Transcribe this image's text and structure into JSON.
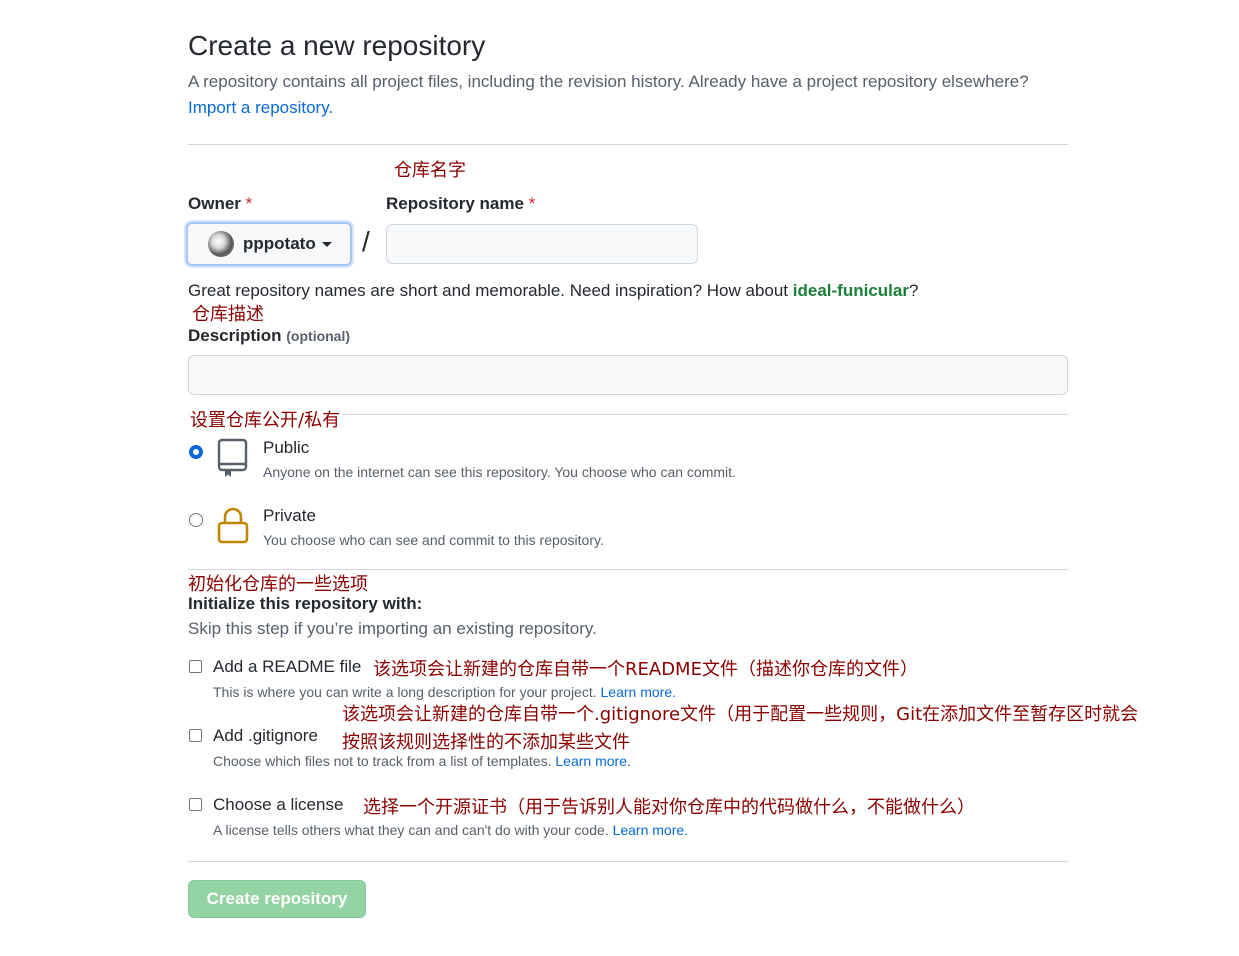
{
  "header": {
    "title": "Create a new repository",
    "subtitle": "A repository contains all project files, including the revision history. Already have a project repository elsewhere?",
    "import_link": "Import a repository."
  },
  "annotations": {
    "repo_name": "仓库名字",
    "description": "仓库描述",
    "visibility": "设置仓库公开/私有",
    "init": "初始化仓库的一些选项",
    "readme": "该选项会让新建的仓库自带一个README文件（描述你仓库的文件）",
    "gitignore_line1": "该选项会让新建的仓库自带一个.gitignore文件（用于配置一些规则，Git在添加文件至暂存区时就会",
    "gitignore_line2": "按照该规则选择性的不添加某些文件",
    "license": "选择一个开源证书（用于告诉别人能对你仓库中的代码做什么，不能做什么）"
  },
  "owner": {
    "label": "Owner",
    "required_mark": "*",
    "name": "pppotato"
  },
  "repo_name": {
    "label": "Repository name",
    "required_mark": "*",
    "value": ""
  },
  "separator": "/",
  "name_hint": {
    "text": "Great repository names are short and memorable. Need inspiration? How about ",
    "suggestion": "ideal-funicular",
    "suffix": "?"
  },
  "description": {
    "label": "Description",
    "optional": "(optional)",
    "value": ""
  },
  "visibility": {
    "public": {
      "title": "Public",
      "desc": "Anyone on the internet can see this repository. You choose who can commit.",
      "checked": true
    },
    "private": {
      "title": "Private",
      "desc": "You choose who can see and commit to this repository.",
      "checked": false
    }
  },
  "init": {
    "title": "Initialize this repository with:",
    "subtitle": "Skip this step if you’re importing an existing repository.",
    "readme": {
      "title": "Add a README file",
      "desc": "This is where you can write a long description for your project.",
      "learn": "Learn more."
    },
    "gitignore": {
      "title": "Add .gitignore",
      "desc": "Choose which files not to track from a list of templates.",
      "learn": "Learn more."
    },
    "license": {
      "title": "Choose a license",
      "desc": "A license tells others what they can and can't do with your code.",
      "learn": "Learn more."
    }
  },
  "submit": {
    "label": "Create repository"
  },
  "colors": {
    "accent": "#0969da",
    "annotation": "#8b0000",
    "submit_bg": "#94d3a2",
    "suggestion": "#1a7f37",
    "lock_icon": "#bf8700"
  }
}
